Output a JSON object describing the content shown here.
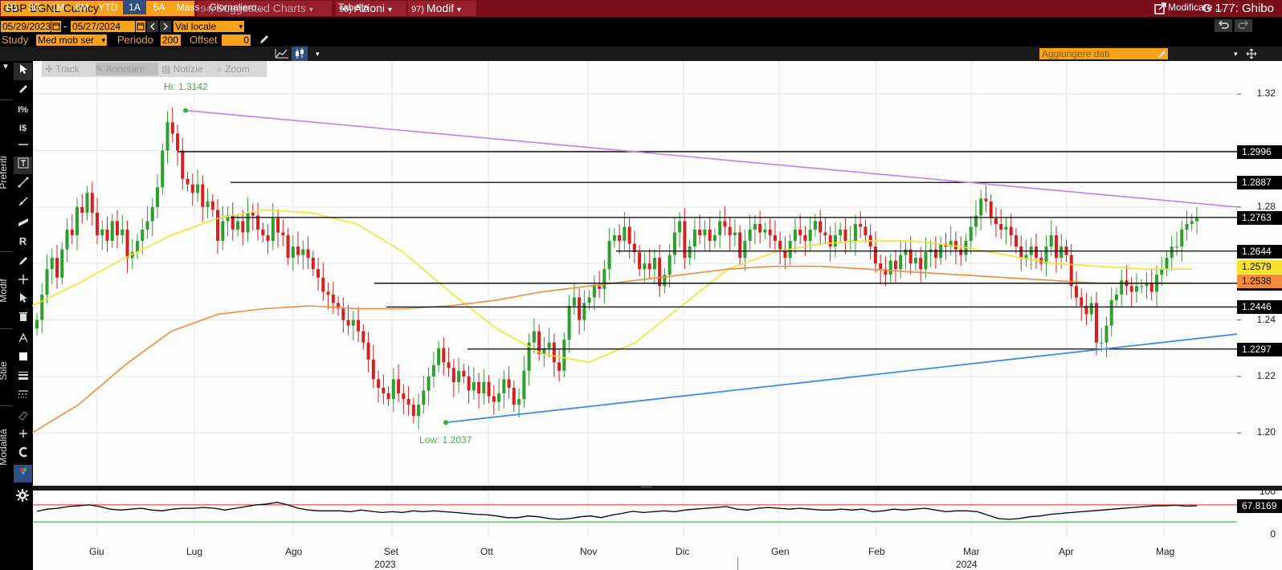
{
  "titlebar": {
    "security": "GBP BGNL Curncy",
    "suggested": {
      "num": "94)",
      "label": "Suggested Charts"
    },
    "azioni": {
      "num": "96)",
      "label": "Azioni"
    },
    "modif": {
      "num": "97)",
      "label": "Modif"
    },
    "graph_title": "G 177: Ghibo",
    "dropdown_glyph": "▾"
  },
  "controls": {
    "start_date": "05/29/2023",
    "end_date": "05/27/2024",
    "date_sep": "-",
    "currency": "Val locale",
    "study_label": "Study",
    "study_value": "Med mob ser",
    "periodo_label": "Periodo",
    "periodo_value": "200",
    "offset_label": "Offset",
    "offset_value": "0"
  },
  "toolbar": {
    "ranges": [
      "1G",
      "3G",
      "1M",
      "6M",
      "YTD",
      "1A",
      "5A",
      "Mass"
    ],
    "selected_range": "1A",
    "periodicity": "Giornaliero...",
    "tabella": "Tabella",
    "aggiungi": "Aggiungere dati",
    "modificare": "Modificare ..."
  },
  "float_toolbar": {
    "track": "Track",
    "annotare": "Annotare",
    "notizie": "Notizie",
    "zoom": "Zoom"
  },
  "side_labels": {
    "preferiti": "Preferiti",
    "modif": "Modif",
    "stile": "Stile",
    "modalita": "Modalità"
  },
  "annotations": {
    "high": "Hi: 1.3142",
    "low": "Low: 1.2037"
  },
  "colors": {
    "up": "#2e9e2e",
    "down": "#d62020",
    "ma_short": "#f2e330",
    "ma_long": "#f28c3c",
    "trend_top": "#c77cf0",
    "trend_bottom": "#3a8ee6",
    "title_bg": "#7a0e1a",
    "accent": "#f7a21b"
  },
  "chart_data": [
    {
      "type": "candlestick",
      "title": "GBP BGNL Curncy",
      "xlabel": "",
      "ylabel": "",
      "ylim": [
        1.185,
        1.33
      ],
      "yticks": [
        1.2,
        1.22,
        1.24,
        1.26,
        1.28,
        1.3,
        1.32
      ],
      "ytick_labels_shown": [
        "1.20",
        "1.22",
        "1.24",
        "1.28",
        "1.32"
      ],
      "month_labels": [
        "Giu",
        "Lug",
        "Ago",
        "Set",
        "Ott",
        "Nov",
        "Dic",
        "Gen",
        "Feb",
        "Mar",
        "Apr",
        "Mag"
      ],
      "year_labels": [
        "2023",
        "2024"
      ],
      "grid": true,
      "close_series": [
        1.24,
        1.249,
        1.258,
        1.262,
        1.255,
        1.265,
        1.272,
        1.27,
        1.28,
        1.278,
        1.285,
        1.278,
        1.27,
        1.272,
        1.268,
        1.275,
        1.27,
        1.272,
        1.262,
        1.264,
        1.268,
        1.272,
        1.275,
        1.28,
        1.287,
        1.3,
        1.31,
        1.306,
        1.3,
        1.29,
        1.288,
        1.285,
        1.288,
        1.28,
        1.282,
        1.279,
        1.268,
        1.275,
        1.277,
        1.272,
        1.275,
        1.271,
        1.278,
        1.277,
        1.272,
        1.27,
        1.268,
        1.276,
        1.271,
        1.27,
        1.262,
        1.266,
        1.263,
        1.265,
        1.262,
        1.258,
        1.255,
        1.25,
        1.249,
        1.246,
        1.244,
        1.24,
        1.238,
        1.24,
        1.236,
        1.232,
        1.226,
        1.219,
        1.216,
        1.214,
        1.212,
        1.219,
        1.214,
        1.212,
        1.21,
        1.206,
        1.21,
        1.215,
        1.22,
        1.224,
        1.23,
        1.225,
        1.223,
        1.218,
        1.222,
        1.22,
        1.215,
        1.218,
        1.214,
        1.218,
        1.213,
        1.211,
        1.214,
        1.219,
        1.216,
        1.21,
        1.212,
        1.222,
        1.232,
        1.236,
        1.228,
        1.23,
        1.232,
        1.225,
        1.222,
        1.233,
        1.245,
        1.248,
        1.24,
        1.246,
        1.248,
        1.252,
        1.251,
        1.258,
        1.268,
        1.27,
        1.268,
        1.273,
        1.267,
        1.264,
        1.258,
        1.26,
        1.258,
        1.262,
        1.252,
        1.256,
        1.263,
        1.271,
        1.275,
        1.262,
        1.266,
        1.272,
        1.27,
        1.272,
        1.268,
        1.27,
        1.275,
        1.273,
        1.27,
        1.271,
        1.262,
        1.268,
        1.272,
        1.274,
        1.271,
        1.272,
        1.27,
        1.268,
        1.265,
        1.262,
        1.268,
        1.272,
        1.27,
        1.268,
        1.272,
        1.275,
        1.271,
        1.27,
        1.266,
        1.27,
        1.272,
        1.268,
        1.268,
        1.274,
        1.273,
        1.27,
        1.266,
        1.26,
        1.258,
        1.256,
        1.261,
        1.258,
        1.263,
        1.265,
        1.26,
        1.262,
        1.258,
        1.264,
        1.265,
        1.262,
        1.267,
        1.266,
        1.268,
        1.265,
        1.263,
        1.268,
        1.273,
        1.277,
        1.283,
        1.282,
        1.276,
        1.274,
        1.272,
        1.273,
        1.27,
        1.266,
        1.262,
        1.263,
        1.266,
        1.262,
        1.26,
        1.266,
        1.27,
        1.262,
        1.266,
        1.263,
        1.252,
        1.248,
        1.245,
        1.242,
        1.246,
        1.232,
        1.232,
        1.238,
        1.247,
        1.249,
        1.254,
        1.252,
        1.25,
        1.252,
        1.252,
        1.253,
        1.25,
        1.256,
        1.258,
        1.262,
        1.266,
        1.266,
        1.272,
        1.274,
        1.275,
        1.276
      ],
      "moving_averages": [
        {
          "name": "Med mob ser 50",
          "color": "#f2e330",
          "approx": [
            1.245,
            1.253,
            1.262,
            1.27,
            1.276,
            1.279,
            1.278,
            1.274,
            1.264,
            1.25,
            1.237,
            1.228,
            1.225,
            1.232,
            1.245,
            1.258,
            1.264,
            1.267,
            1.268,
            1.268,
            1.266,
            1.263,
            1.26,
            1.259,
            1.258,
            1.258
          ]
        },
        {
          "name": "Med mob ser 200",
          "color": "#f28c3c",
          "approx": [
            1.2,
            1.21,
            1.224,
            1.236,
            1.242,
            1.244,
            1.245,
            1.244,
            1.244,
            1.245,
            1.247,
            1.25,
            1.252,
            1.254,
            1.256,
            1.258,
            1.259,
            1.259,
            1.258,
            1.257,
            1.256,
            1.255,
            1.254,
            1.253,
            1.253,
            1.253
          ]
        }
      ],
      "annotations": [
        {
          "label": "Hi: 1.3142",
          "value": 1.3142
        },
        {
          "label": "Low: 1.2037",
          "value": 1.2037
        }
      ],
      "horizontal_levels": [
        1.2996,
        1.2887,
        1.2763,
        1.2644,
        1.253,
        1.2446,
        1.2297
      ],
      "level_labels": [
        "1.2996",
        "1.2887",
        "1.2763",
        "1.2644",
        "1.253",
        "1.2446",
        "1.2297"
      ],
      "ma_labels": [
        "1.2579",
        "1.2538"
      ],
      "trendlines": [
        {
          "color": "#c77cf0",
          "from": 1.3142,
          "to": 1.28
        },
        {
          "color": "#3a8ee6",
          "from": 1.2037,
          "to": 1.235
        }
      ]
    },
    {
      "type": "line",
      "title": "",
      "ylim": [
        0,
        100
      ],
      "yticks": [
        0,
        33,
        67,
        100
      ],
      "ytick_labels": [
        "100",
        "0"
      ],
      "upper_band": 70,
      "lower_band": 30,
      "last_value": "67.8169",
      "values": [
        55,
        60,
        62,
        66,
        68,
        70,
        66,
        60,
        58,
        60,
        62,
        58,
        56,
        60,
        62,
        62,
        64,
        62,
        58,
        62,
        66,
        70,
        72,
        76,
        70,
        62,
        58,
        56,
        56,
        56,
        54,
        58,
        55,
        52,
        54,
        52,
        56,
        54,
        56,
        54,
        52,
        50,
        48,
        47,
        44,
        40,
        40,
        44,
        42,
        38,
        36,
        38,
        42,
        44,
        40,
        46,
        50,
        55,
        52,
        54,
        56,
        54,
        58,
        60,
        62,
        64,
        66,
        60,
        58,
        62,
        64,
        62,
        60,
        62,
        60,
        58,
        58,
        60,
        58,
        60,
        54,
        56,
        60,
        58,
        60,
        62,
        58,
        54,
        56,
        56,
        54,
        46,
        38,
        36,
        38,
        42,
        44,
        48,
        50,
        52,
        54,
        56,
        58,
        60,
        62,
        64,
        66,
        68,
        68,
        69,
        67,
        68
      ]
    }
  ]
}
